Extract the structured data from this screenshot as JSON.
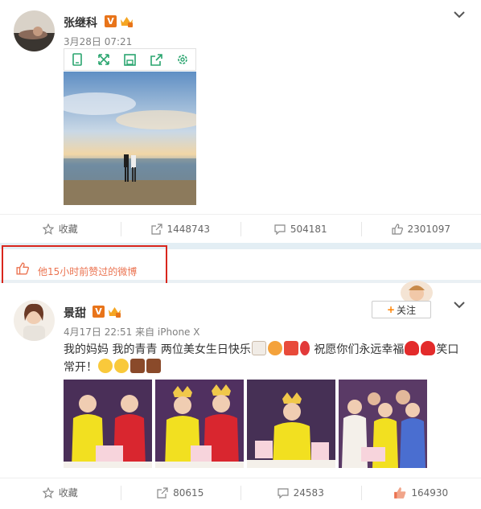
{
  "post1": {
    "username": "张继科",
    "verified_badge": "V",
    "date": "3月28日 07:21",
    "toolbar_icons": [
      "phone-view-icon",
      "expand-icon",
      "save-icon",
      "share-icon",
      "settings-icon"
    ],
    "actions": {
      "favorite": "收藏",
      "repost": "1448743",
      "comment": "504181",
      "like": "2301097"
    }
  },
  "liked_notice": {
    "text": "他15小时前赞过的微博"
  },
  "post2": {
    "username": "景甜",
    "verified_badge": "V",
    "meta": "4月17日 22:51 来自 iPhone X",
    "follow_label": "关注",
    "text_line1_a": "我的妈妈 我的青青 两位美女生日快乐",
    "text_line1_b": "祝愿你们永远幸福",
    "text_line1_c": "笑口",
    "text_line2": "常开！",
    "actions": {
      "favorite": "收藏",
      "repost": "80615",
      "comment": "24583",
      "like": "164930"
    }
  },
  "colors": {
    "orange": "#eb7350",
    "red_box": "#d9261c",
    "badge": "#e8741a"
  }
}
